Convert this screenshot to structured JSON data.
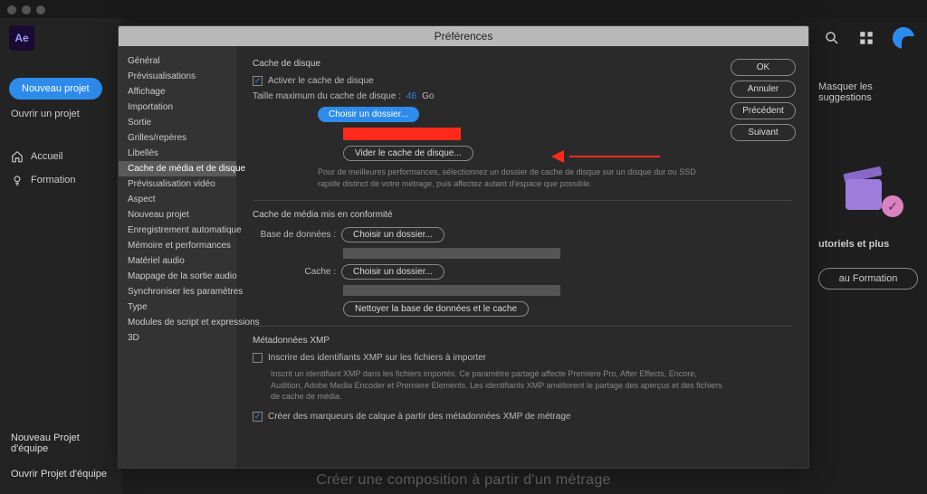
{
  "window": {
    "title": "Préférences"
  },
  "app": {
    "logo": "Ae",
    "new_project_btn": "Nouveau projet",
    "open_project": "Ouvrir un projet",
    "nav_home": "Accueil",
    "nav_training": "Formation",
    "new_team_project": "Nouveau Projet d'équipe",
    "open_team_project": "Ouvrir Projet d'équipe",
    "bottom_truncated": "Créer une composition à partir d'un métrage"
  },
  "right_bg": {
    "hide_suggestions": "Masquer les suggestions",
    "tutorials": "utoriels et plus",
    "training_btn": "au Formation"
  },
  "prefs_buttons": {
    "ok": "OK",
    "cancel": "Annuler",
    "prev": "Précédent",
    "next": "Suivant"
  },
  "prefs_categories": [
    "Général",
    "Prévisualisations",
    "Affichage",
    "Importation",
    "Sortie",
    "Grilles/repères",
    "Libellés",
    "Cache de média et de disque",
    "Prévisualisation vidéo",
    "Aspect",
    "Nouveau projet",
    "Enregistrement automatique",
    "Mémoire et performances",
    "Matériel audio",
    "Mappage de la sortie audio",
    "Synchroniser les paramètres",
    "Type",
    "Modules de script et expressions",
    "3D"
  ],
  "content": {
    "disk_cache_title": "Cache de disque",
    "enable_disk_cache": "Activer le cache de disque",
    "max_size_label": "Taille maximum du cache de disque :",
    "max_size_value": "46",
    "max_size_unit": "Go",
    "choose_folder": "Choisir un dossier...",
    "empty_disk_cache": "Vider le cache de disque...",
    "disk_cache_hint": "Pour de meilleures performances, sélectionnez un dossier de cache de disque sur un disque dur ou SSD rapide distinct de votre métrage, puis affectez autant d'espace que possible.",
    "conformed_title": "Cache de média mis en conformité",
    "db_label": "Base de données :",
    "cache_label": "Cache :",
    "clean_db_cache": "Nettoyer la base de données et le cache",
    "xmp_title": "Métadonnées XMP",
    "xmp_write": "Inscrire des identifiants XMP sur les fichiers à importer",
    "xmp_write_desc": "Inscrit un identifiant XMP dans les fichiers importés. Ce paramètre partagé affecte Premiere Pro, After Effects, Encore, Audition, Adobe Media Encoder et Premiere Elements. Les identifiants XMP améliorent le partage des aperçus et des fichiers de cache de média.",
    "xmp_markers": "Créer des marqueurs de calque à partir des métadonnées XMP de métrage"
  }
}
